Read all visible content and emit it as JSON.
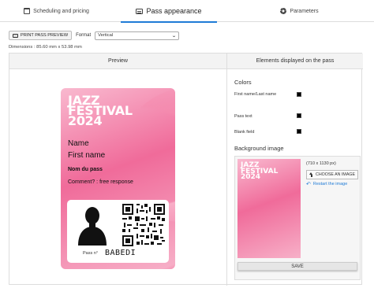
{
  "tabs": [
    {
      "label": "Scheduling and pricing",
      "icon": "calendar-icon"
    },
    {
      "label": "Pass appearance",
      "icon": "id-card-icon"
    },
    {
      "label": "Parameters",
      "icon": "gear-icon"
    }
  ],
  "toolbar": {
    "print_label": "PRINT PASS PREVIEW",
    "format_label": "Format",
    "format_value": "Vertical"
  },
  "dimensions": "Dimensions : 85.60 mm x 53.98 mm",
  "preview": {
    "header": "Preview",
    "badge": {
      "title_lines": [
        "JAZZ",
        "FESTIVAL",
        "2024"
      ],
      "name": "Name",
      "first_name": "First name",
      "pass_name": "Nom du pass",
      "comment": "Comment? : free response",
      "pass_no_label": "Pass n°",
      "pass_no_value": "BABEDI"
    }
  },
  "elements": {
    "header": "Elements displayed on the pass",
    "colors_title": "Colors",
    "color_rows": [
      {
        "label": "First name/Last name",
        "swatch": "#000000"
      },
      {
        "label": "Pass text",
        "swatch": "#000000"
      },
      {
        "label": "Blank field",
        "swatch": "#000000"
      }
    ],
    "bg_title": "Background image",
    "thumb_title_lines": [
      "JAZZ",
      "FESTIVAL",
      "2024"
    ],
    "image_size": "(710 x 1130 px)",
    "choose_label": "CHOOSE AN IMAGE",
    "restart_label": "Restart the image",
    "save_label": "SAVE"
  },
  "colors": {
    "accent": "#1f7bd6",
    "badge_pink": "#f06b9a"
  }
}
